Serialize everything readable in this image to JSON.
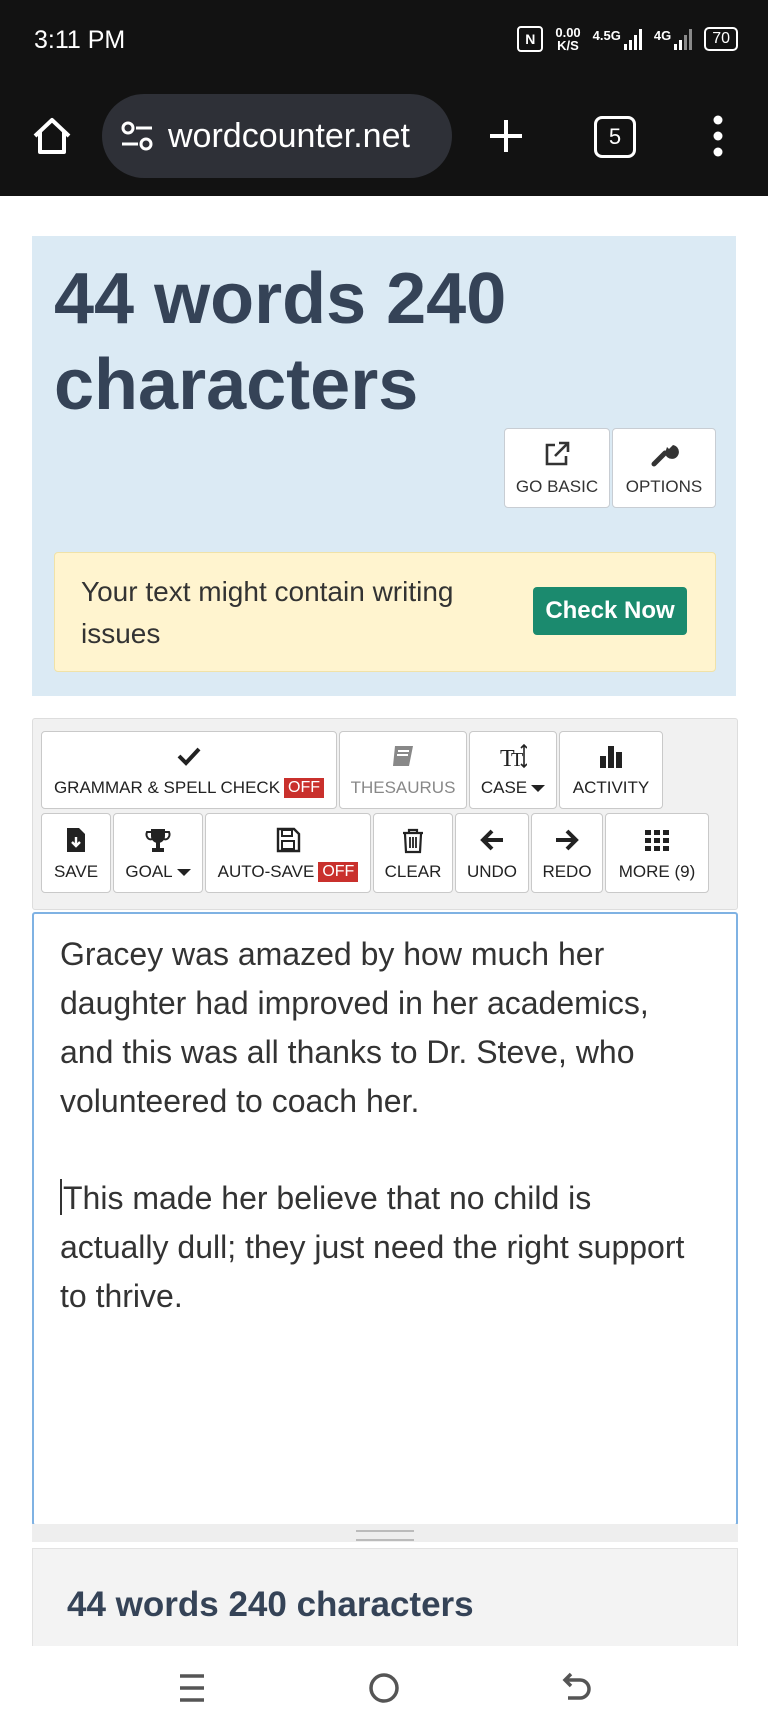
{
  "status": {
    "time": "3:11 PM",
    "nfc": "N",
    "speed_value": "0.00",
    "speed_unit": "K/S",
    "net1": "4.5G",
    "net2": "4G",
    "battery": "70"
  },
  "browser": {
    "url": "wordcounter.net",
    "tab_count": "5"
  },
  "counter": {
    "headline": "44 words 240 characters",
    "go_basic_label": "GO BASIC",
    "options_label": "OPTIONS",
    "issue_text": "Your text might contain writing issues",
    "check_now_label": "Check Now"
  },
  "toolbar": {
    "grammar_label": "GRAMMAR & SPELL CHECK",
    "grammar_state": "OFF",
    "thesaurus_label": "THESAURUS",
    "case_label": "CASE",
    "activity_label": "ACTIVITY",
    "save_label": "SAVE",
    "goal_label": "GOAL",
    "autosave_label": "AUTO-SAVE",
    "autosave_state": "OFF",
    "clear_label": "CLEAR",
    "undo_label": "UNDO",
    "redo_label": "REDO",
    "more_label": "MORE (9)"
  },
  "editor": {
    "paragraph1": "Gracey was amazed by how much her daughter had improved in her academics, and this was all thanks to Dr. Steve, who volunteered to coach her.",
    "paragraph2": "This made her believe that no child is actually dull; they just need the right support to thrive."
  },
  "summary": {
    "count": "44 words 240 characters"
  }
}
